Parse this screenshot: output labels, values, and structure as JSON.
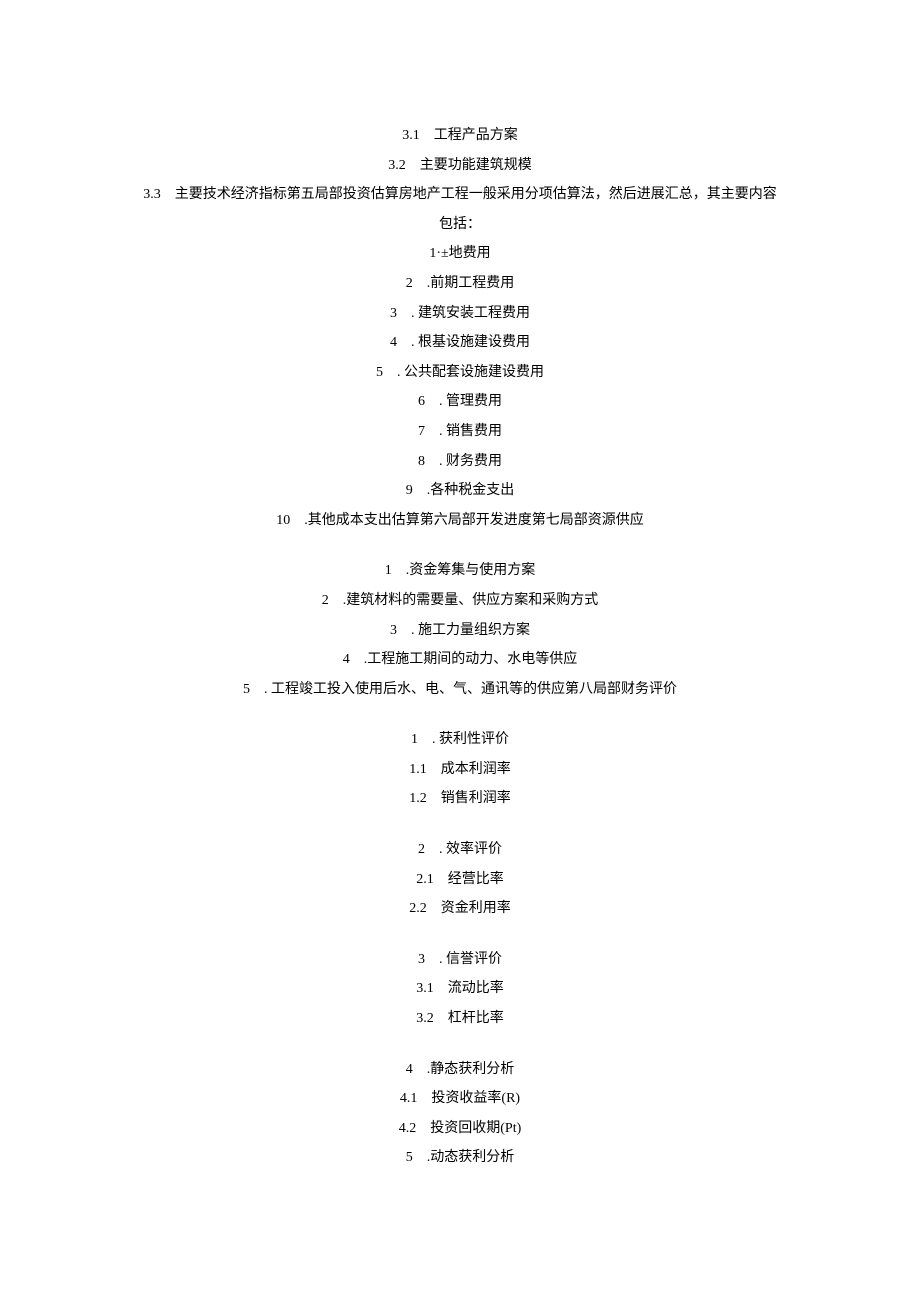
{
  "lines": [
    "3.1　工程产品方案",
    "3.2　主要功能建筑规模",
    "3.3　主要技术经济指标第五局部投资估算房地产工程一般采用分项估算法，然后进展汇总，其主要内容",
    "包括：",
    "1·±地费用",
    "2　.前期工程费用",
    "3　. 建筑安装工程费用",
    "4　. 根基设施建设费用",
    "5　. 公共配套设施建设费用",
    "6　. 管理费用",
    "7　. 销售费用",
    "8　. 财务费用",
    "9　.各种税金支出",
    "10　.其他成本支出估算第六局部开发进度第七局部资源供应",
    "",
    "1　.资金筹集与使用方案",
    "2　.建筑材料的需要量、供应方案和采购方式",
    "3　. 施工力量组织方案",
    "4　.工程施工期间的动力、水电等供应",
    "5　. 工程竣工投入使用后水、电、气、通讯等的供应第八局部财务评价",
    "",
    "1　. 获利性评价",
    "1.1　成本利润率",
    "1.2　销售利润率",
    "",
    "2　. 效率评价",
    "2.1　经营比率",
    "2.2　资金利用率",
    "",
    "3　. 信誉评价",
    "3.1　流动比率",
    "3.2　杠杆比率",
    "",
    "4　.静态获利分析",
    "4.1　投资收益率(R)",
    "4.2　投资回收期(Pt)",
    "5　.动态获利分析"
  ]
}
